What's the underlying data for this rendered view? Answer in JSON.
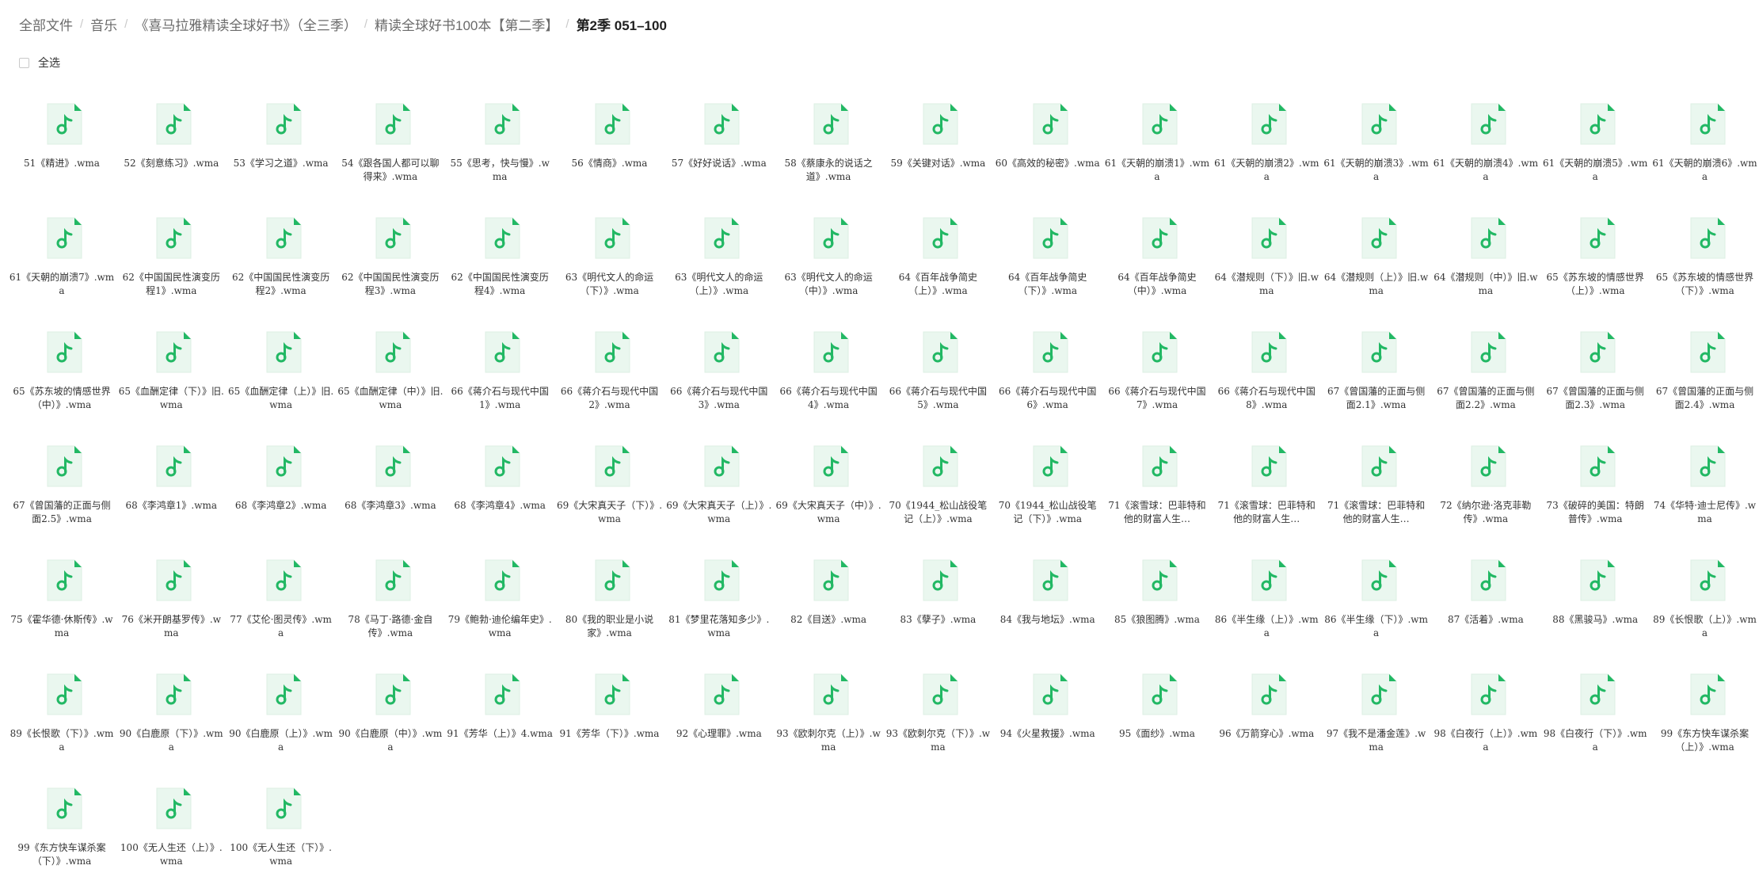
{
  "breadcrumb": {
    "items": [
      "全部文件",
      "音乐",
      "《喜马拉雅精读全球好书》（全三季）",
      "精读全球好书100本【第二季】",
      "第2季 051–100"
    ]
  },
  "toolbar": {
    "select_all_label": "全选"
  },
  "colors": {
    "icon_fill": "#eaf7ef",
    "icon_accent": "#22b864",
    "separator": "#c9c9c9"
  },
  "icon": "music-file-icon",
  "files": [
    "51《精进》.wma",
    "52《刻意练习》.wma",
    "53《学习之道》.wma",
    "54《跟各国人都可以聊得来》.wma",
    "55《思考，快与慢》.wma",
    "56《情商》.wma",
    "57《好好说话》.wma",
    "58《蔡康永的说话之道》.wma",
    "59《关键对话》.wma",
    "60《高效的秘密》.wma",
    "61《天朝的崩溃1》.wma",
    "61《天朝的崩溃2》.wma",
    "61《天朝的崩溃3》.wma",
    "61《天朝的崩溃4》.wma",
    "61《天朝的崩溃5》.wma",
    "61《天朝的崩溃6》.wma",
    "61《天朝的崩溃7》.wma",
    "62《中国国民性演变历程1》.wma",
    "62《中国国民性演变历程2》.wma",
    "62《中国国民性演变历程3》.wma",
    "62《中国国民性演变历程4》.wma",
    "63《明代文人的命运（下）》.wma",
    "63《明代文人的命运（上）》.wma",
    "63《明代文人的命运（中）》.wma",
    "64《百年战争简史（上）》.wma",
    "64《百年战争简史（下）》.wma",
    "64《百年战争简史（中）》.wma",
    "64《潜规则（下）》旧.wma",
    "64《潜规则（上）》旧.wma",
    "64《潜规则（中）》旧.wma",
    "65《苏东坡的情感世界（上）》.wma",
    "65《苏东坡的情感世界（下）》.wma",
    "65《苏东坡的情感世界（中）》.wma",
    "65《血酬定律（下）》旧.wma",
    "65《血酬定律（上）》旧.wma",
    "65《血酬定律（中）》旧.wma",
    "66《蒋介石与现代中国1》.wma",
    "66《蒋介石与现代中国2》.wma",
    "66《蒋介石与现代中国3》.wma",
    "66《蒋介石与现代中国4》.wma",
    "66《蒋介石与现代中国5》.wma",
    "66《蒋介石与现代中国6》.wma",
    "66《蒋介石与现代中国7》.wma",
    "66《蒋介石与现代中国8》.wma",
    "67《曾国藩的正面与侧面2.1》.wma",
    "67《曾国藩的正面与侧面2.2》.wma",
    "67《曾国藩的正面与侧面2.3》.wma",
    "67《曾国藩的正面与侧面2.4》.wma",
    "67《曾国藩的正面与侧面2.5》.wma",
    "68《李鸿章1》.wma",
    "68《李鸿章2》.wma",
    "68《李鸿章3》.wma",
    "68《李鸿章4》.wma",
    "69《大宋真天子（下）》.wma",
    "69《大宋真天子（上）》.wma",
    "69《大宋真天子（中）》.wma",
    "70《1944_松山战役笔记（上）》.wma",
    "70《1944_松山战役笔记（下）》.wma",
    "71《滚雪球：巴菲特和他的财富人生…",
    "71《滚雪球：巴菲特和他的财富人生…",
    "71《滚雪球：巴菲特和他的财富人生…",
    "72《纳尔逊·洛克菲勒传》.wma",
    "73《破碎的美国：特朗普传》.wma",
    "74《华特·迪士尼传》.wma",
    "75《霍华德·休斯传》.wma",
    "76《米开朗基罗传》.wma",
    "77《艾伦·图灵传》.wma",
    "78《马丁·路德·金自传》.wma",
    "79《鲍勃·迪伦编年史》.wma",
    "80《我的职业是小说家》.wma",
    "81《梦里花落知多少》.wma",
    "82《目送》.wma",
    "83《孽子》.wma",
    "84《我与地坛》.wma",
    "85《狼图腾》.wma",
    "86《半生缘（上）》.wma",
    "86《半生缘（下）》.wma",
    "87《活着》.wma",
    "88《黑骏马》.wma",
    "89《长恨歌（上）》.wma",
    "89《长恨歌（下）》.wma",
    "90《白鹿原（下）》.wma",
    "90《白鹿原（上）》.wma",
    "90《白鹿原（中）》.wma",
    "91《芳华（上）》4.wma",
    "91《芳华（下）》.wma",
    "92《心理罪》.wma",
    "93《欧刺尔克（上）》.wma",
    "93《欧刺尔克（下）》.wma",
    "94《火星救援》.wma",
    "95《面纱》.wma",
    "96《万箭穿心》.wma",
    "97《我不是潘金莲》.wma",
    "98《白夜行（上）》.wma",
    "98《白夜行（下）》.wma",
    "99《东方快车谋杀案（上）》.wma",
    "99《东方快车谋杀案（下）》.wma",
    "100《无人生还（上）》.wma",
    "100《无人生还（下）》.wma"
  ]
}
